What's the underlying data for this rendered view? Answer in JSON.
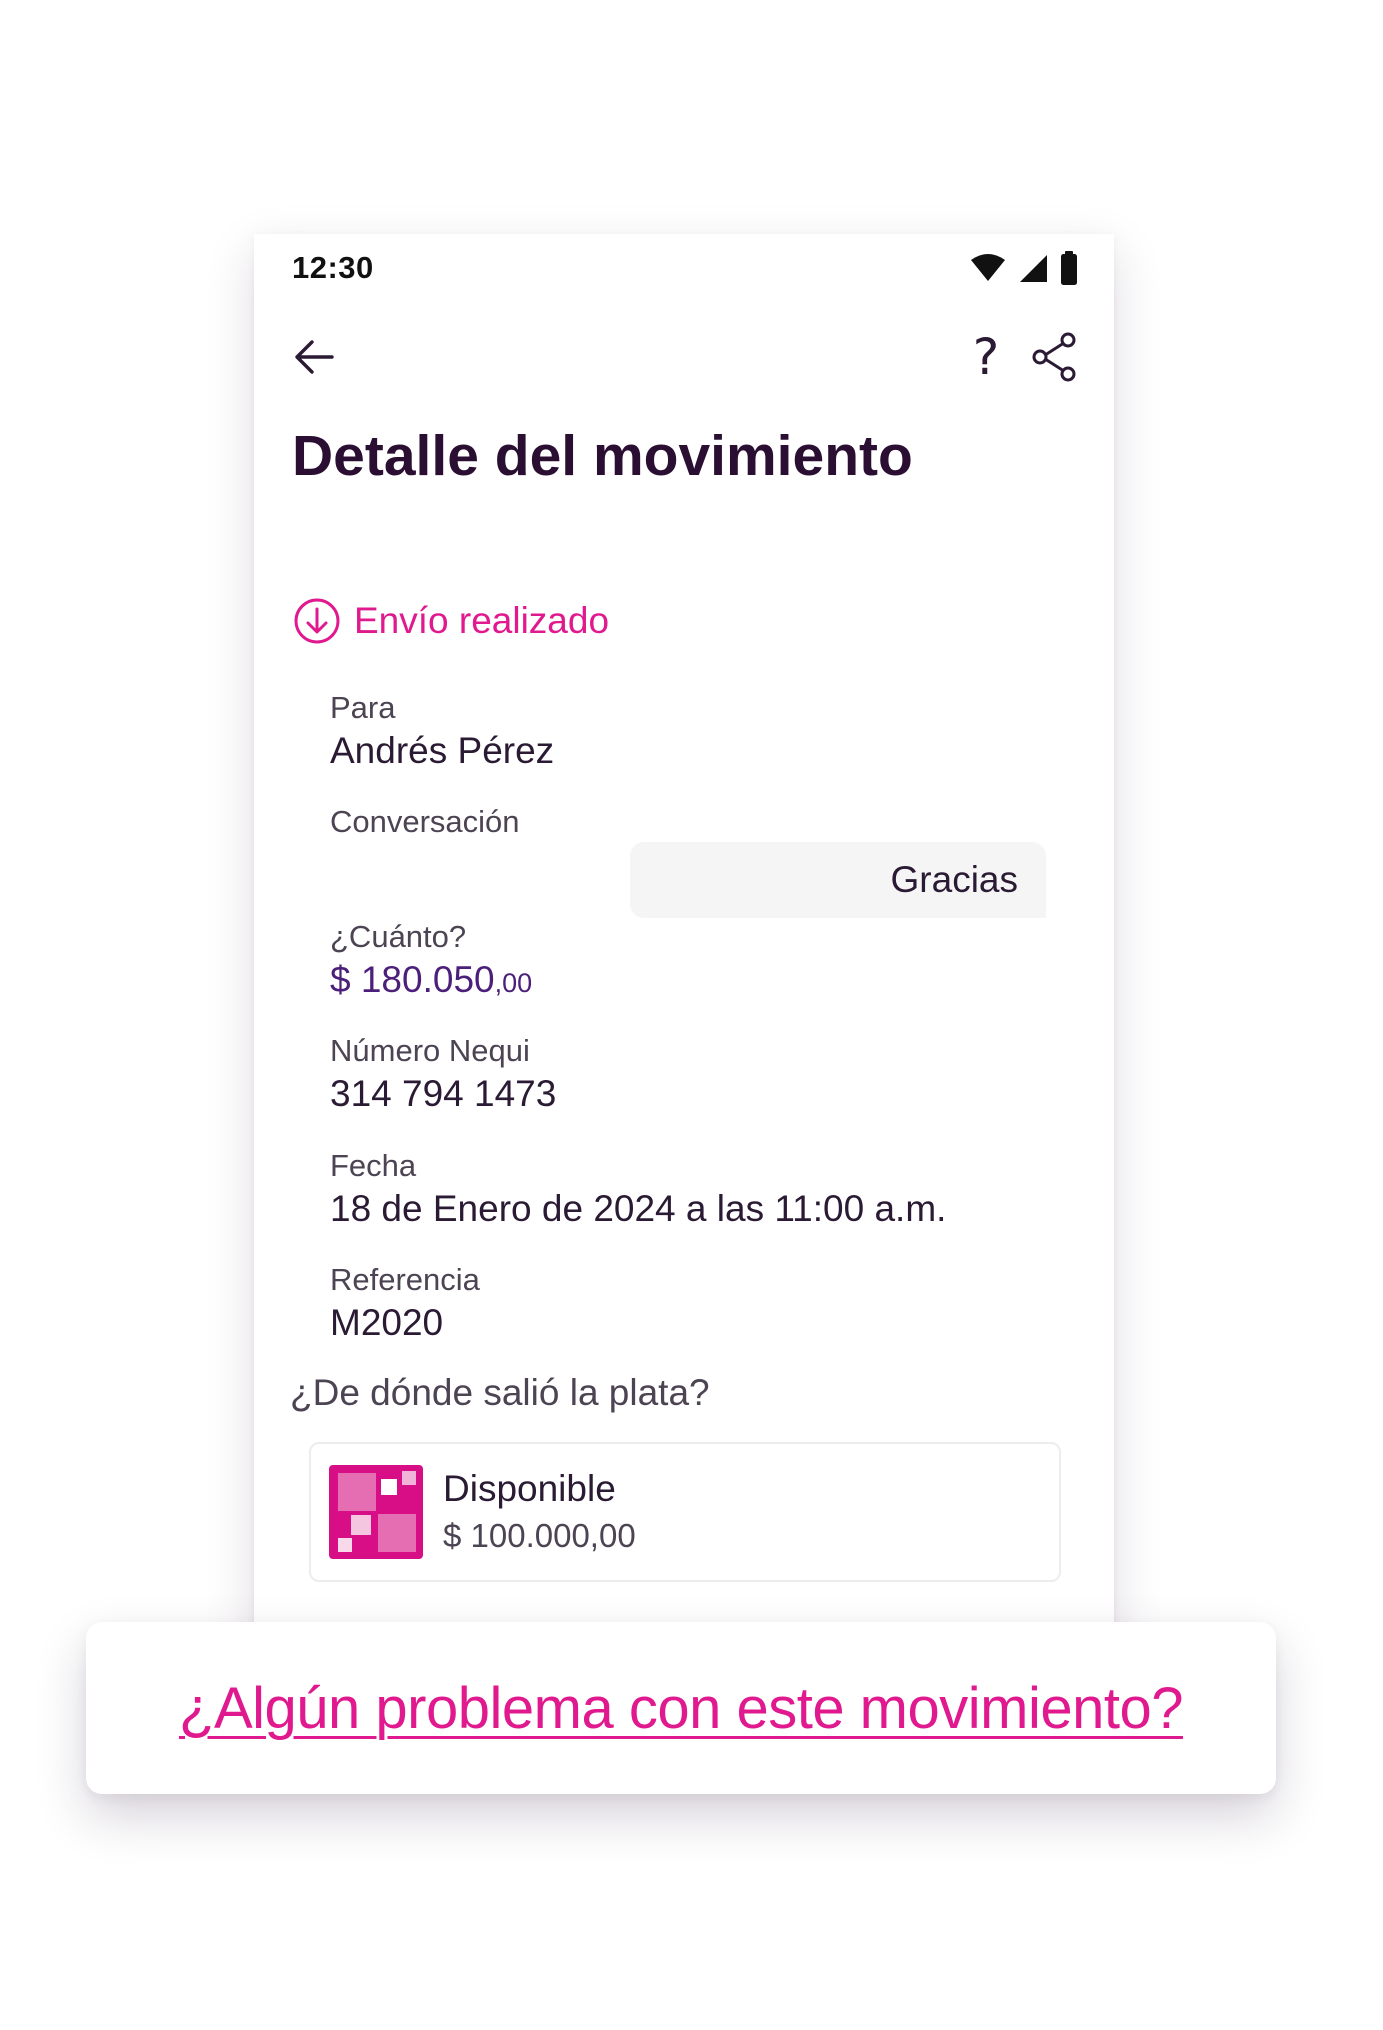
{
  "status_bar": {
    "time": "12:30",
    "icons": [
      "wifi-icon",
      "cellular-signal-icon",
      "battery-icon"
    ]
  },
  "app_bar": {
    "back_icon": "arrow-left-icon",
    "help_label": "?",
    "share_icon": "share-icon"
  },
  "page": {
    "title": "Detalle del movimiento"
  },
  "movement": {
    "status_icon": "arrow-down-circle-icon",
    "status_label": "Envío realizado",
    "to_label": "Para",
    "to_value": "Andrés Pérez",
    "conversation_label": "Conversación",
    "conversation_message": "Gracias",
    "amount_label": "¿Cuánto?",
    "amount_main": "$ 180.050",
    "amount_cents": ",00",
    "number_label": "Número Nequi",
    "number_value": "314 794 1473",
    "date_label": "Fecha",
    "date_value": "18 de Enero de 2024 a las 11:00 a.m.",
    "reference_label": "Referencia",
    "reference_value": "M2020"
  },
  "source": {
    "question": "¿De dónde salió la plata?",
    "pocket_icon": "pocket-grid-icon",
    "pocket_name": "Disponible",
    "pocket_amount": "$ 100.000,00"
  },
  "problem_link": {
    "label": "¿Algún problema con este movimiento?"
  },
  "colors": {
    "accent_pink": "#e0198f",
    "amount_purple": "#4b1f7a",
    "title_dark": "#2a0f33"
  }
}
